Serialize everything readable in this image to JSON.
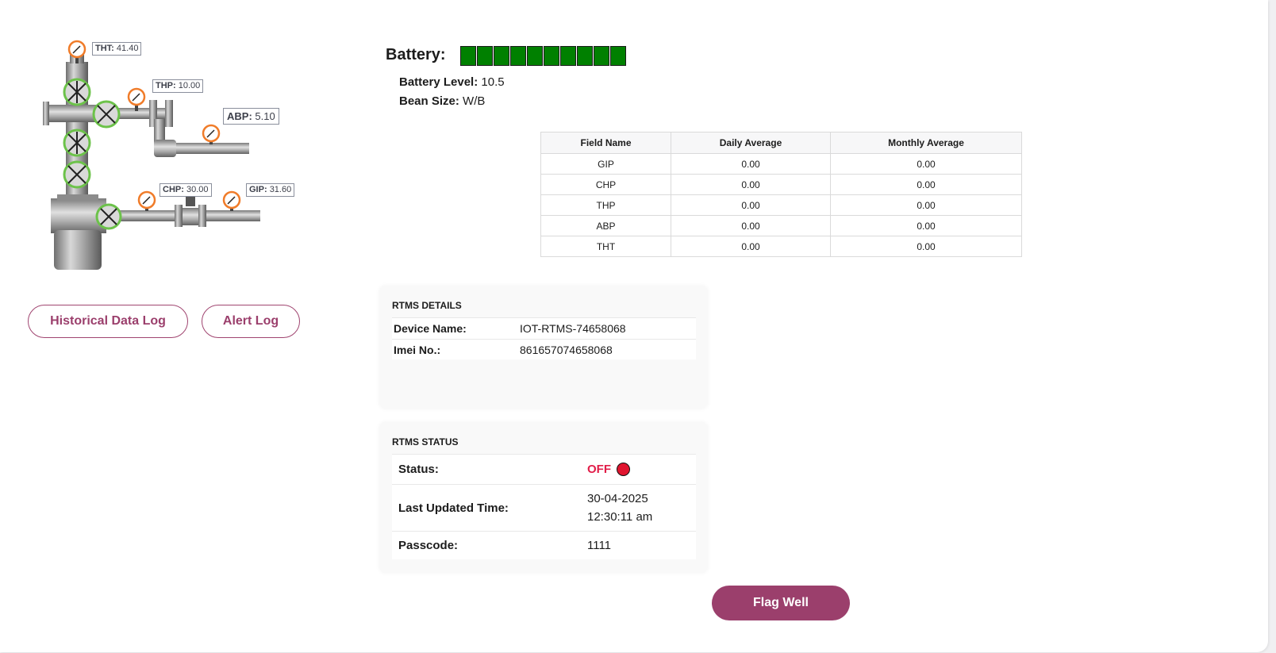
{
  "diagram": {
    "tht": {
      "name": "THT",
      "value": "41.40"
    },
    "thp": {
      "name": "THP",
      "value": "10.00"
    },
    "abp": {
      "name": "ABP",
      "value": "5.10"
    },
    "chp": {
      "name": "CHP",
      "value": "30.00"
    },
    "gip": {
      "name": "GIP",
      "value": "31.60"
    },
    "sep": ":"
  },
  "actions": {
    "historical": "Historical Data Log",
    "alert": "Alert Log",
    "flag": "Flag Well"
  },
  "battery": {
    "label": "Battery:",
    "cells": 10,
    "level_label": "Battery Level:",
    "level_value": "10.5",
    "bean_label": "Bean Size:",
    "bean_value": "W/B",
    "color": "#008000"
  },
  "averages": {
    "headers": [
      "Field Name",
      "Daily Average",
      "Monthly Average"
    ],
    "rows": [
      [
        "GIP",
        "0.00",
        "0.00"
      ],
      [
        "CHP",
        "0.00",
        "0.00"
      ],
      [
        "THP",
        "0.00",
        "0.00"
      ],
      [
        "ABP",
        "0.00",
        "0.00"
      ],
      [
        "THT",
        "0.00",
        "0.00"
      ]
    ]
  },
  "rtms_details": {
    "title": "RTMS DETAILS",
    "device_label": "Device Name:",
    "device_value": "IOT-RTMS-74658068",
    "imei_label": "Imei No.:",
    "imei_value": "861657074658068"
  },
  "rtms_status": {
    "title": "RTMS STATUS",
    "status_label": "Status:",
    "status_value": "OFF",
    "updated_label": "Last Updated Time:",
    "updated_date": "30-04-2025",
    "updated_time": "12:30:11 am",
    "passcode_label": "Passcode:",
    "passcode_value": "1111",
    "status_color": "#e11d48"
  },
  "colors": {
    "accent": "#9b3f6c",
    "valve_ring": "#6cc24a",
    "gauge_ring": "#f07c2a"
  }
}
